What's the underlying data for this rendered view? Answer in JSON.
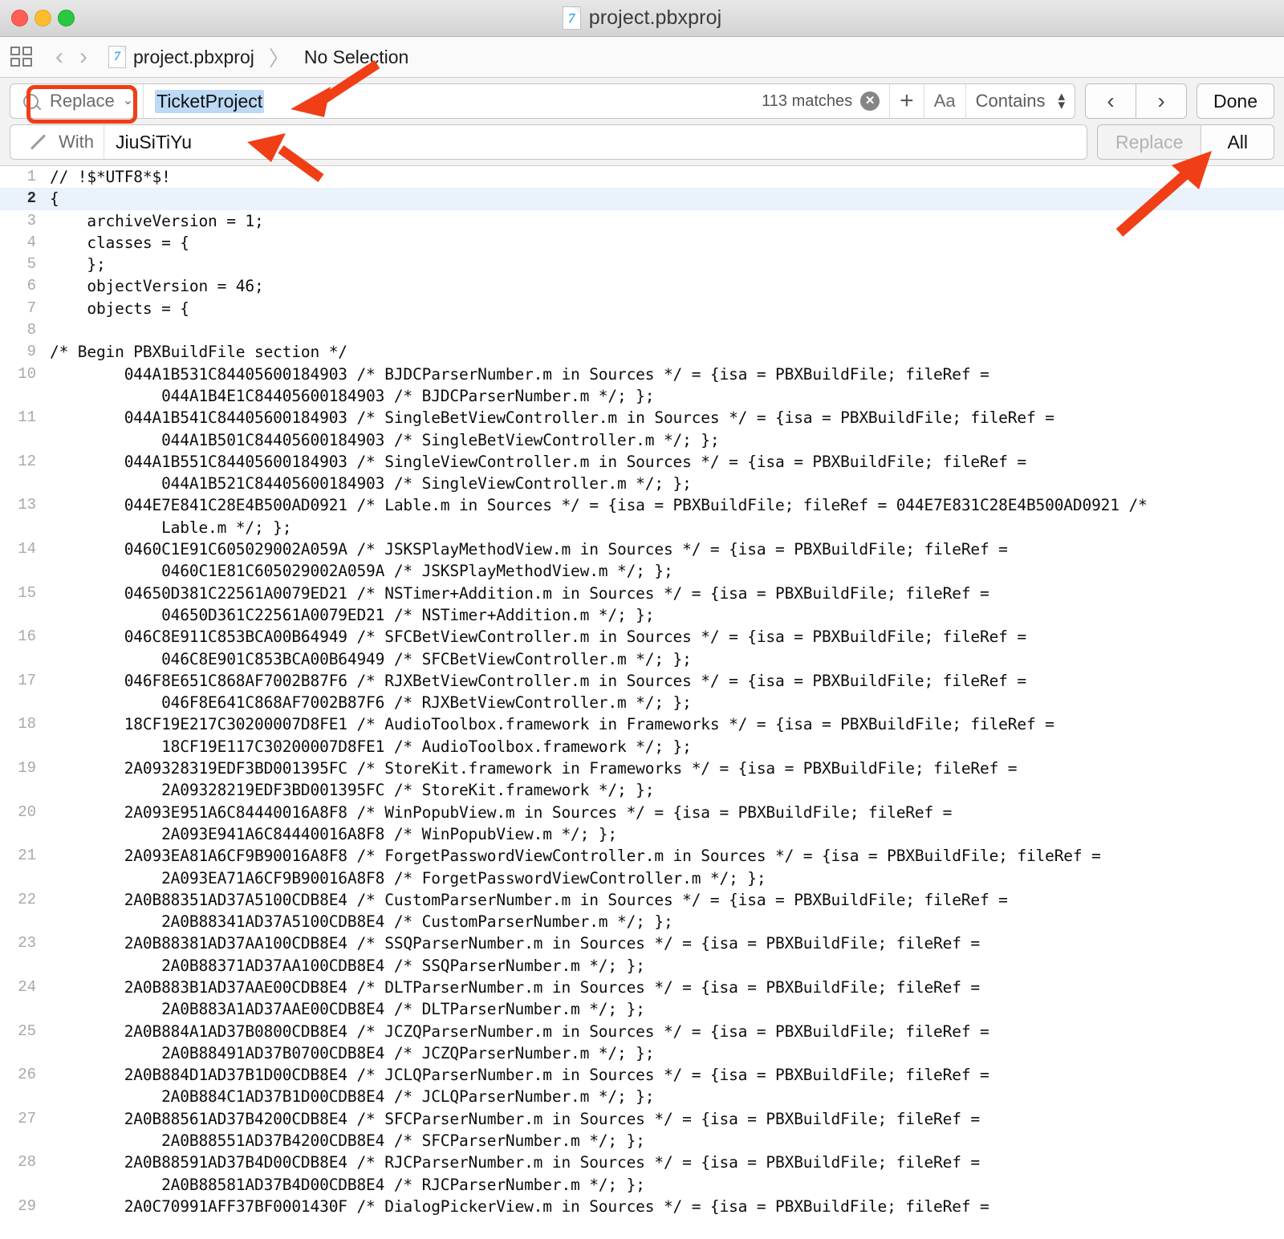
{
  "window": {
    "title": "project.pbxproj",
    "file_icon_glyph": "7",
    "traffic_lights": [
      "close",
      "minimize",
      "maximize"
    ]
  },
  "jumpbar": {
    "grid_icon": "related-items-icon",
    "back_glyph": "‹",
    "forward_glyph": "›",
    "file_icon_glyph": "7",
    "crumbs": [
      "project.pbxproj",
      "No Selection"
    ],
    "separator": "〉"
  },
  "find": {
    "mode_label": "Replace",
    "mode_chevron": "⌄",
    "query": "TicketProject",
    "query_placeholder": "Search",
    "matches": "113 matches",
    "clear_glyph": "✕",
    "add_glyph": "+",
    "case_glyph": "Aa",
    "scope": "Contains",
    "stepper_up": "▴",
    "stepper_down": "▾",
    "prev_glyph": "‹",
    "next_glyph": "›",
    "done_label": "Done"
  },
  "replace": {
    "with_label": "With",
    "with_value": "JiuSiTiYu",
    "with_placeholder": "Replace",
    "replace_label": "Replace",
    "all_label": "All"
  },
  "annotations": {
    "highlight_color": "#f03e16",
    "selection_color": "#bcd9f5"
  },
  "editor": {
    "lines": [
      {
        "num": "1",
        "text": "// !$*UTF8*$!"
      },
      {
        "num": "2",
        "text": "{",
        "highlight": true
      },
      {
        "num": "3",
        "text": "\tarchiveVersion = 1;"
      },
      {
        "num": "4",
        "text": "\tclasses = {"
      },
      {
        "num": "5",
        "text": "\t};"
      },
      {
        "num": "6",
        "text": "\tobjectVersion = 46;"
      },
      {
        "num": "7",
        "text": "\tobjects = {"
      },
      {
        "num": "8",
        "text": ""
      },
      {
        "num": "9",
        "text": "/* Begin PBXBuildFile section */"
      },
      {
        "num": "10",
        "text": "\t\t044A1B531C84405600184903 /* BJDCParserNumber.m in Sources */ = {isa = PBXBuildFile; fileRef =",
        "cont": "\t\t\t044A1B4E1C84405600184903 /* BJDCParserNumber.m */; };"
      },
      {
        "num": "11",
        "text": "\t\t044A1B541C84405600184903 /* SingleBetViewController.m in Sources */ = {isa = PBXBuildFile; fileRef =",
        "cont": "\t\t\t044A1B501C84405600184903 /* SingleBetViewController.m */; };"
      },
      {
        "num": "12",
        "text": "\t\t044A1B551C84405600184903 /* SingleViewController.m in Sources */ = {isa = PBXBuildFile; fileRef =",
        "cont": "\t\t\t044A1B521C84405600184903 /* SingleViewController.m */; };"
      },
      {
        "num": "13",
        "text": "\t\t044E7E841C28E4B500AD0921 /* Lable.m in Sources */ = {isa = PBXBuildFile; fileRef = 044E7E831C28E4B500AD0921 /*",
        "cont": "\t\t\tLable.m */; };"
      },
      {
        "num": "14",
        "text": "\t\t0460C1E91C605029002A059A /* JSKSPlayMethodView.m in Sources */ = {isa = PBXBuildFile; fileRef =",
        "cont": "\t\t\t0460C1E81C605029002A059A /* JSKSPlayMethodView.m */; };"
      },
      {
        "num": "15",
        "text": "\t\t04650D381C22561A0079ED21 /* NSTimer+Addition.m in Sources */ = {isa = PBXBuildFile; fileRef =",
        "cont": "\t\t\t04650D361C22561A0079ED21 /* NSTimer+Addition.m */; };"
      },
      {
        "num": "16",
        "text": "\t\t046C8E911C853BCA00B64949 /* SFCBetViewController.m in Sources */ = {isa = PBXBuildFile; fileRef =",
        "cont": "\t\t\t046C8E901C853BCA00B64949 /* SFCBetViewController.m */; };"
      },
      {
        "num": "17",
        "text": "\t\t046F8E651C868AF7002B87F6 /* RJXBetViewController.m in Sources */ = {isa = PBXBuildFile; fileRef =",
        "cont": "\t\t\t046F8E641C868AF7002B87F6 /* RJXBetViewController.m */; };"
      },
      {
        "num": "18",
        "text": "\t\t18CF19E217C30200007D8FE1 /* AudioToolbox.framework in Frameworks */ = {isa = PBXBuildFile; fileRef =",
        "cont": "\t\t\t18CF19E117C30200007D8FE1 /* AudioToolbox.framework */; };"
      },
      {
        "num": "19",
        "text": "\t\t2A09328319EDF3BD001395FC /* StoreKit.framework in Frameworks */ = {isa = PBXBuildFile; fileRef =",
        "cont": "\t\t\t2A09328219EDF3BD001395FC /* StoreKit.framework */; };"
      },
      {
        "num": "20",
        "text": "\t\t2A093E951A6C84440016A8F8 /* WinPopubView.m in Sources */ = {isa = PBXBuildFile; fileRef =",
        "cont": "\t\t\t2A093E941A6C84440016A8F8 /* WinPopubView.m */; };"
      },
      {
        "num": "21",
        "text": "\t\t2A093EA81A6CF9B90016A8F8 /* ForgetPasswordViewController.m in Sources */ = {isa = PBXBuildFile; fileRef =",
        "cont": "\t\t\t2A093EA71A6CF9B90016A8F8 /* ForgetPasswordViewController.m */; };"
      },
      {
        "num": "22",
        "text": "\t\t2A0B88351AD37A5100CDB8E4 /* CustomParserNumber.m in Sources */ = {isa = PBXBuildFile; fileRef =",
        "cont": "\t\t\t2A0B88341AD37A5100CDB8E4 /* CustomParserNumber.m */; };"
      },
      {
        "num": "23",
        "text": "\t\t2A0B88381AD37AA100CDB8E4 /* SSQParserNumber.m in Sources */ = {isa = PBXBuildFile; fileRef =",
        "cont": "\t\t\t2A0B88371AD37AA100CDB8E4 /* SSQParserNumber.m */; };"
      },
      {
        "num": "24",
        "text": "\t\t2A0B883B1AD37AAE00CDB8E4 /* DLTParserNumber.m in Sources */ = {isa = PBXBuildFile; fileRef =",
        "cont": "\t\t\t2A0B883A1AD37AAE00CDB8E4 /* DLTParserNumber.m */; };"
      },
      {
        "num": "25",
        "text": "\t\t2A0B884A1AD37B0800CDB8E4 /* JCZQParserNumber.m in Sources */ = {isa = PBXBuildFile; fileRef =",
        "cont": "\t\t\t2A0B88491AD37B0700CDB8E4 /* JCZQParserNumber.m */; };"
      },
      {
        "num": "26",
        "text": "\t\t2A0B884D1AD37B1D00CDB8E4 /* JCLQParserNumber.m in Sources */ = {isa = PBXBuildFile; fileRef =",
        "cont": "\t\t\t2A0B884C1AD37B1D00CDB8E4 /* JCLQParserNumber.m */; };"
      },
      {
        "num": "27",
        "text": "\t\t2A0B88561AD37B4200CDB8E4 /* SFCParserNumber.m in Sources */ = {isa = PBXBuildFile; fileRef =",
        "cont": "\t\t\t2A0B88551AD37B4200CDB8E4 /* SFCParserNumber.m */; };"
      },
      {
        "num": "28",
        "text": "\t\t2A0B88591AD37B4D00CDB8E4 /* RJCParserNumber.m in Sources */ = {isa = PBXBuildFile; fileRef =",
        "cont": "\t\t\t2A0B88581AD37B4D00CDB8E4 /* RJCParserNumber.m */; };"
      },
      {
        "num": "29",
        "text": "\t\t2A0C70991AFF37BF0001430F /* DialogPickerView.m in Sources */ = {isa = PBXBuildFile; fileRef ="
      }
    ]
  }
}
